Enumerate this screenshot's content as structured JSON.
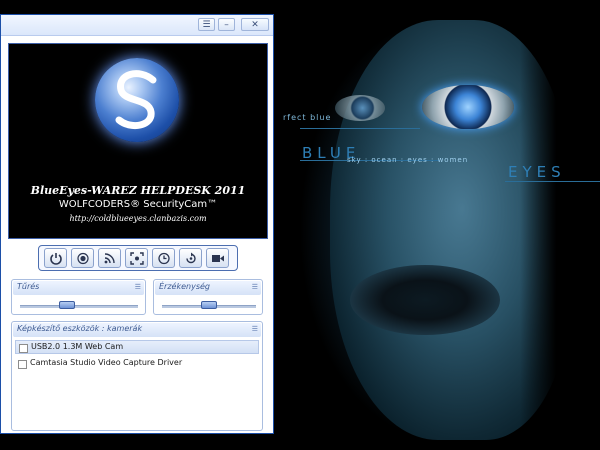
{
  "background": {
    "word_blue": "BLUE",
    "word_eyes": "EYES",
    "perfect_blue": "rfect blue",
    "tagline": "sky : ocean : eyes : women"
  },
  "window": {
    "title_buttons": {
      "menu": "☰",
      "minimize": "–",
      "close": "✕"
    },
    "banner": {
      "line1": "BlueEyes-WAREZ HELPDESK 2011",
      "line2": "WOLFCODERS® SecurityCam™",
      "line3": "http://coldblueeyes.clanbazis.com"
    },
    "toolbar": {
      "buttons": [
        {
          "icon": "power-icon"
        },
        {
          "icon": "record-icon"
        },
        {
          "icon": "signal-icon"
        },
        {
          "icon": "fullscreen-icon"
        },
        {
          "icon": "clock-icon"
        },
        {
          "icon": "rotate-icon"
        },
        {
          "icon": "camera-icon"
        }
      ]
    },
    "tolerance": {
      "title": "Tűrés",
      "level": 0.38
    },
    "sensitivity": {
      "title": "Érzékenység",
      "level": 0.5
    },
    "devices": {
      "title": "Képkészítő eszközök : kamerák",
      "items": [
        {
          "label": "USB2.0 1.3M Web Cam",
          "selected": true
        },
        {
          "label": "Camtasia Studio Video Capture Driver",
          "selected": false
        }
      ]
    }
  },
  "colors": {
    "accent": "#1c4fa8",
    "panel_head": "#d5e2f7",
    "eye_blue": "#3c84d6"
  }
}
